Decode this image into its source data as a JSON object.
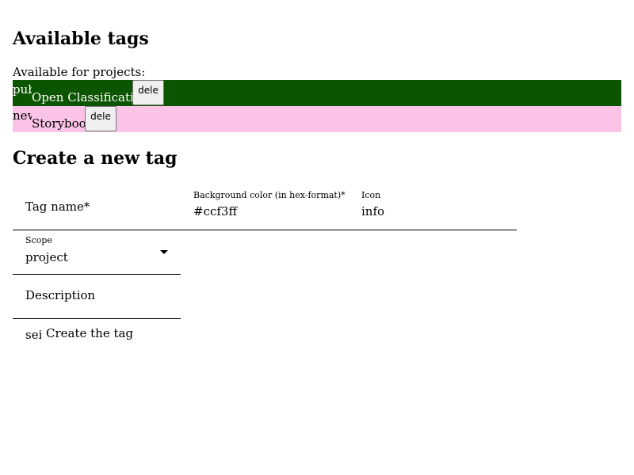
{
  "available": {
    "title": "Available tags",
    "label": "Available for projects:",
    "tags": [
      {
        "icon": "pub",
        "name": "Open Classification",
        "delete_label": "dele",
        "bg": "#0b5500",
        "fg": "#ffffff"
      },
      {
        "icon": "new",
        "name": "Storybook",
        "delete_label": "dele",
        "bg": "#fbc3e6",
        "fg": "#000000"
      }
    ]
  },
  "create": {
    "title": "Create a new tag",
    "tag_name_label": "Tag name*",
    "bg_label": "Background color (in hex-format)*",
    "bg_value": "#ccf3ff",
    "icon_label": "Icon",
    "icon_value": "info",
    "scope_label": "Scope",
    "scope_value": "project",
    "description_label": "Description",
    "truncated_text": "sei",
    "submit_label": "Create the tag"
  }
}
